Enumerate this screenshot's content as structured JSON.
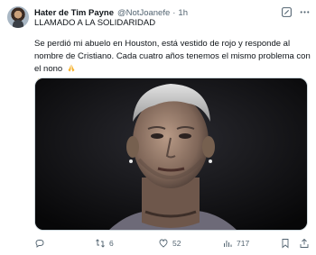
{
  "author": {
    "name": "Hater de Tim Payne",
    "handle": "@NotJoanefe",
    "separator": "·",
    "time": "1h"
  },
  "tweet": {
    "title_line": "LLAMADO A LA SOLIDARIDAD",
    "body": "Se perdió mi abuelo en Houston, está vestido de rojo y responde al nombre de Cristiano. Cada cuatro años tenemos el mismo problema con el nono",
    "emojis": [
      "folded-hands",
      "folded-hands",
      "folded-hands"
    ]
  },
  "media": {
    "kind": "photo",
    "description_icon": "portrait-photo"
  },
  "actions": {
    "replies": "",
    "reposts": "6",
    "likes": "52",
    "views": "717"
  },
  "colors": {
    "text": "#0f1419",
    "muted": "#536471",
    "emoji": "#f5b12c"
  }
}
